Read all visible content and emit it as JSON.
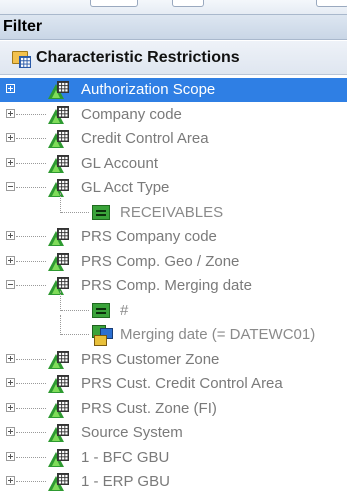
{
  "panel": {
    "title": "Filter"
  },
  "section": {
    "title": "Characteristic Restrictions",
    "icon": "characteristic-folder-icon"
  },
  "tree": [
    {
      "label": "Authorization Scope",
      "expander": "plus",
      "icon": "characteristic-icon",
      "selected": true
    },
    {
      "label": "Company code",
      "expander": "plus",
      "icon": "characteristic-icon"
    },
    {
      "label": "Credit Control Area",
      "expander": "plus",
      "icon": "characteristic-icon"
    },
    {
      "label": "GL Account",
      "expander": "plus",
      "icon": "characteristic-icon"
    },
    {
      "label": "GL Acct Type",
      "expander": "minus",
      "icon": "characteristic-icon"
    },
    {
      "label": "RECEIVABLES",
      "icon": "equals-icon",
      "child": true
    },
    {
      "label": "PRS Company code",
      "expander": "plus",
      "icon": "characteristic-icon"
    },
    {
      "label": "PRS Comp. Geo / Zone",
      "expander": "plus",
      "icon": "characteristic-icon"
    },
    {
      "label": "PRS Comp. Merging date",
      "expander": "minus",
      "icon": "characteristic-icon"
    },
    {
      "label": "#",
      "icon": "equals-icon",
      "child": true
    },
    {
      "label": "Merging date (= DATEWC01)",
      "icon": "variable-icon",
      "child": true
    },
    {
      "label": "PRS Customer Zone",
      "expander": "plus",
      "icon": "characteristic-icon"
    },
    {
      "label": "PRS Cust. Credit Control Area",
      "expander": "plus",
      "icon": "characteristic-icon"
    },
    {
      "label": "PRS Cust. Zone (FI)",
      "expander": "plus",
      "icon": "characteristic-icon"
    },
    {
      "label": "Source System",
      "expander": "plus",
      "icon": "characteristic-icon"
    },
    {
      "label": "1 - BFC GBU",
      "expander": "plus",
      "icon": "characteristic-icon"
    },
    {
      "label": "1 - ERP GBU",
      "expander": "plus",
      "icon": "characteristic-icon"
    }
  ],
  "colors": {
    "selection": "#2f7fe4",
    "text": "#7a7a7a",
    "icon_green": "#2e9a31"
  }
}
